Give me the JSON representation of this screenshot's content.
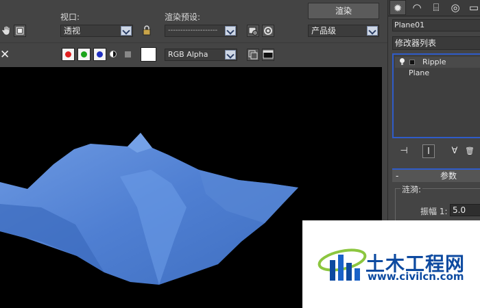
{
  "toolbar": {
    "viewport_label": "视口:",
    "viewport_value": "透视",
    "preset_label": "渲染预设:",
    "preset_value": "--------------------",
    "render_button": "渲染",
    "quality_value": "产品级",
    "channel_value": "RGB Alpha",
    "close_glyph": "✕"
  },
  "colors": {
    "red_channel": "#e02020",
    "green_channel": "#1aa31a",
    "blue_channel": "#2030c0",
    "mesh_blue": "#5b8ad6",
    "highlight_border": "#2f5cc9"
  },
  "panel": {
    "tabs": [
      {
        "icon": "sun-icon",
        "glyph": "✹"
      },
      {
        "icon": "curve-icon",
        "glyph": "◠"
      },
      {
        "icon": "hierarchy-icon",
        "glyph": "⌸"
      },
      {
        "icon": "motion-icon",
        "glyph": "◎"
      },
      {
        "icon": "display-icon",
        "glyph": "▭"
      }
    ],
    "object_name": "Plane01",
    "modifier_list": "修改器列表",
    "stack": [
      {
        "label": "Ripple"
      },
      {
        "label": "Plane"
      }
    ],
    "tools": [
      {
        "icon": "pin-stack-icon",
        "glyph": "⊣"
      },
      {
        "icon": "show-end-result-icon",
        "glyph": "I"
      },
      {
        "icon": "make-unique-icon",
        "glyph": "∀"
      },
      {
        "icon": "remove-modifier-icon",
        "glyph": "🗑"
      }
    ],
    "rollout_toggle": "-",
    "rollout_title": "参数",
    "group_label": "涟漪:",
    "amplitude_label": "振幅 1:",
    "amplitude_value": "5.0"
  },
  "watermark": {
    "title": "土木工程网",
    "url": "www.civilcn.com"
  }
}
